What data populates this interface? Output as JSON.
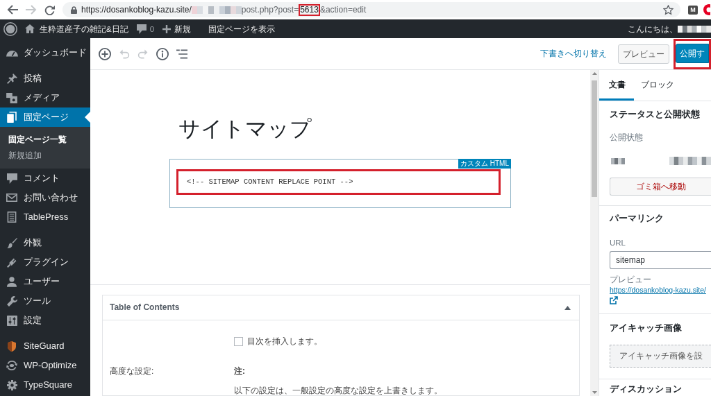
{
  "browser": {
    "forward_disabled": true,
    "url": {
      "origin": "https://dosankoblog-kazu.site/",
      "path": "post.php?post=",
      "post_id": "5613",
      "post_id_highlighted": true,
      "query_rest": "&action=edit"
    },
    "extension_label": "M"
  },
  "admin_bar": {
    "site_name": "生粋道産子の雑記&日記",
    "comment_count": "0",
    "new_label": "新規",
    "view_page": "固定ページを表示",
    "greeting": "こんにちは、"
  },
  "sidebar": {
    "groups": [
      {
        "items": [
          {
            "label": "ダッシュボード",
            "selected": false
          }
        ]
      },
      {
        "items": [
          {
            "label": "投稿",
            "selected": false
          },
          {
            "label": "メディア",
            "selected": false
          },
          {
            "label": "固定ページ",
            "selected": true,
            "children": [
              {
                "label": "固定ページ一覧",
                "selected": true
              },
              {
                "label": "新規追加",
                "selected": false
              }
            ]
          },
          {
            "label": "コメント",
            "selected": false
          },
          {
            "label": "お問い合わせ",
            "selected": false
          },
          {
            "label": "TablePress",
            "selected": false
          }
        ]
      },
      {
        "items": [
          {
            "label": "外観",
            "selected": false
          },
          {
            "label": "プラグイン",
            "selected": false
          },
          {
            "label": "ユーザー",
            "selected": false
          },
          {
            "label": "ツール",
            "selected": false
          },
          {
            "label": "設定",
            "selected": false
          }
        ]
      },
      {
        "items": [
          {
            "label": "SiteGuard",
            "selected": false
          },
          {
            "label": "WP-Optimize",
            "selected": false
          },
          {
            "label": "TypeSquare",
            "selected": false
          }
        ]
      }
    ]
  },
  "editor": {
    "toolbar": {
      "tools": [
        {
          "disabled": false
        },
        {
          "disabled": true
        },
        {
          "disabled": true
        },
        {
          "disabled": false
        },
        {
          "disabled": false
        }
      ],
      "draft_link": "下書きへ切り替え",
      "preview_button": "プレビュー",
      "publish_button": {
        "label": "公開す",
        "highlighted": true
      }
    },
    "title": "サイトマップ",
    "html_block": {
      "label": "カスタム HTML",
      "code": "<!-- SITEMAP CONTENT REPLACE POINT -->",
      "highlighted": true
    },
    "meta_box": {
      "title": "Table of Contents",
      "expanded": true,
      "insert_toc": {
        "label": "目次を挿入します。",
        "checked": false
      },
      "advanced_label": "高度な設定:",
      "note_title": "注:",
      "note_text": "以下の設定は、一般設定の高度な設定を上書きします。"
    }
  },
  "settings_panel": {
    "tabs": [
      {
        "label": "文書",
        "selected": true
      },
      {
        "label": "ブロック",
        "selected": false
      }
    ],
    "status": {
      "title": "ステータスと公開状態",
      "visibility_label": "公開状態",
      "trash_button": "ゴミ箱へ移動"
    },
    "permalink": {
      "title": "パーマリンク",
      "url_label": "URL",
      "slug": "sitemap",
      "preview_label": "プレビュー",
      "preview_link": "https://dosankoblog-kazu.site/"
    },
    "featured_image": {
      "title": "アイキャッチ画像",
      "button": "アイキャッチ画像を設"
    },
    "discussion": {
      "title": "ディスカッション"
    }
  }
}
